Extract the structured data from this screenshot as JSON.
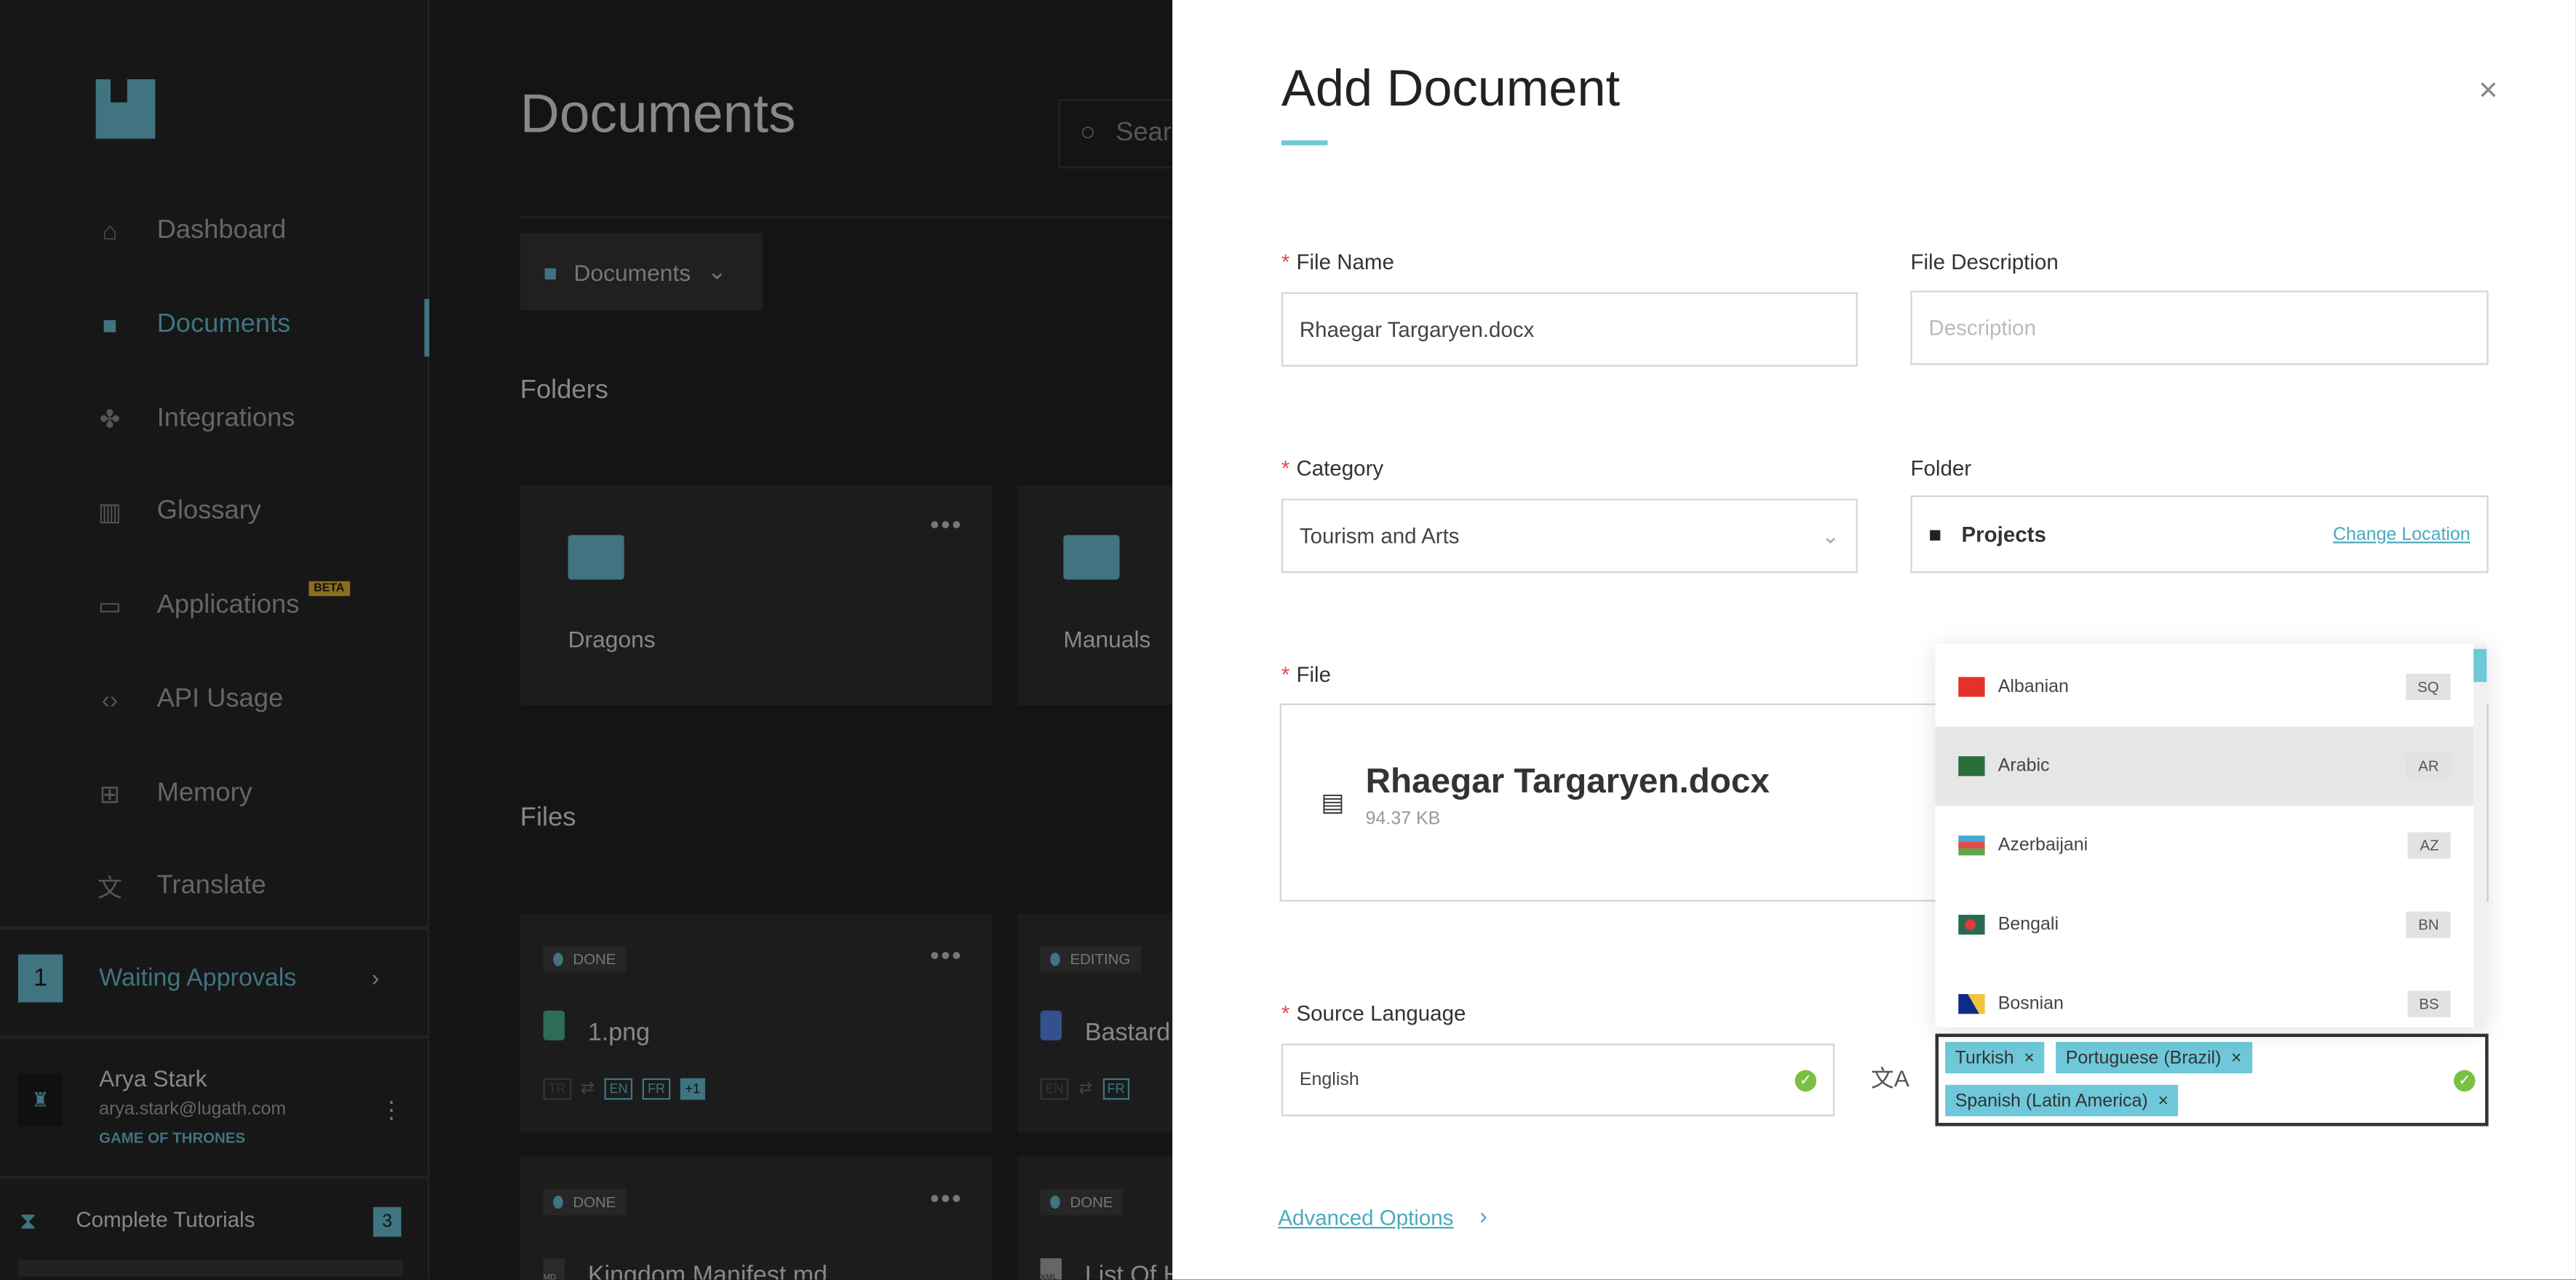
{
  "sidebar": {
    "nav": [
      {
        "label": "Dashboard",
        "icon": "home-icon"
      },
      {
        "label": "Documents",
        "icon": "folder-icon",
        "active": true
      },
      {
        "label": "Integrations",
        "icon": "puzzle-icon"
      },
      {
        "label": "Glossary",
        "icon": "book-icon"
      },
      {
        "label": "Applications",
        "icon": "devices-icon",
        "badge": "BETA"
      },
      {
        "label": "API Usage",
        "icon": "code-icon"
      },
      {
        "label": "Memory",
        "icon": "chip-icon"
      },
      {
        "label": "Translate",
        "icon": "translate-icon"
      }
    ],
    "waiting": {
      "count": "1",
      "label": "Waiting Approvals"
    },
    "user": {
      "name": "Arya Stark",
      "email": "arya.stark@lugath.com",
      "org": "GAME OF THRONES"
    },
    "tutorials": {
      "label": "Complete Tutorials",
      "count": "3"
    }
  },
  "main": {
    "title": "Documents",
    "search_placeholder": "Search",
    "folder_select": "Documents",
    "folders_heading": "Folders",
    "folders": [
      "Dragons",
      "Manuals"
    ],
    "files_heading": "Files",
    "files": [
      {
        "status": "DONE",
        "name": "1.png",
        "source": "TR",
        "targets": [
          "EN",
          "FR"
        ],
        "more": "+1"
      },
      {
        "status": "EDITING",
        "name": "Bastard",
        "source": "EN",
        "targets": [
          "FR"
        ]
      },
      {
        "status": "DONE",
        "name": "Kingdom Manifest.md",
        "type": "MD"
      },
      {
        "status": "DONE",
        "name": "List Of H",
        "type": "XML"
      }
    ]
  },
  "panel": {
    "title": "Add Document",
    "accent": "#6ec8d9",
    "file_name": {
      "label": "File Name",
      "value": "Rhaegar Targaryen.docx"
    },
    "file_description": {
      "label": "File Description",
      "placeholder": "Description"
    },
    "category": {
      "label": "Category",
      "value": "Tourism and Arts"
    },
    "folder": {
      "label": "Folder",
      "value": "Projects",
      "change": "Change Location"
    },
    "file": {
      "label": "File",
      "name": "Rhaegar Targaryen.docx",
      "size": "94.37 KB"
    },
    "source_language": {
      "label": "Source Language",
      "value": "English"
    },
    "language_options": [
      {
        "name": "Albanian",
        "code": "SQ"
      },
      {
        "name": "Arabic",
        "code": "AR",
        "highlighted": true
      },
      {
        "name": "Azerbaijani",
        "code": "AZ"
      },
      {
        "name": "Bengali",
        "code": "BN"
      },
      {
        "name": "Bosnian",
        "code": "BS"
      }
    ],
    "target_languages": [
      "Turkish",
      "Portuguese (Brazil)",
      "Spanish (Latin America)"
    ],
    "advanced": "Advanced Options"
  }
}
